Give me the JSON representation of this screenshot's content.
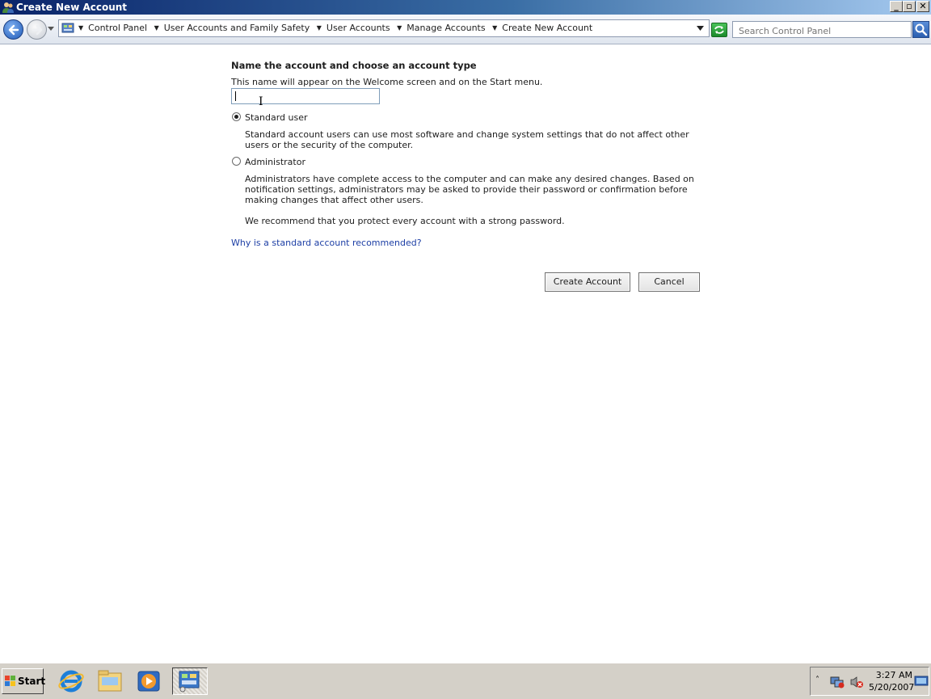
{
  "window": {
    "title": "Create New Account"
  },
  "address_bar": {
    "crumbs": [
      {
        "label": "Control Panel"
      },
      {
        "label": "User Accounts and Family Safety"
      },
      {
        "label": "User Accounts"
      },
      {
        "label": "Manage Accounts"
      },
      {
        "label": "Create New Account"
      }
    ],
    "search_placeholder": "Search Control Panel"
  },
  "form": {
    "heading": "Name the account and choose an account type",
    "helper": "This name will appear on the Welcome screen and on the Start menu.",
    "name_value": "",
    "options": [
      {
        "label": "Standard user",
        "selected": true,
        "description": "Standard account users can use most software and change system settings that do not affect other users or the security of the computer."
      },
      {
        "label": "Administrator",
        "selected": false,
        "description": "Administrators have complete access to the computer and can make any desired changes. Based on notification settings, administrators may be asked to provide their password or confirmation before making changes that affect other users.",
        "recommendation": "We recommend that you protect every account with a strong password."
      }
    ],
    "help_link": "Why is a standard account recommended?",
    "create_button": "Create Account",
    "cancel_button": "Cancel"
  },
  "taskbar": {
    "start_label": "Start",
    "quick_launch": [
      "internet-explorer-icon",
      "windows-explorer-icon",
      "media-player-icon",
      "control-panel-icon"
    ],
    "clock_time": "3:27 AM",
    "clock_date": "5/20/2007"
  },
  "colors": {
    "title_bar": "#0a246a",
    "link": "#1c3ea5",
    "taskbar": "#d4d0c8"
  }
}
